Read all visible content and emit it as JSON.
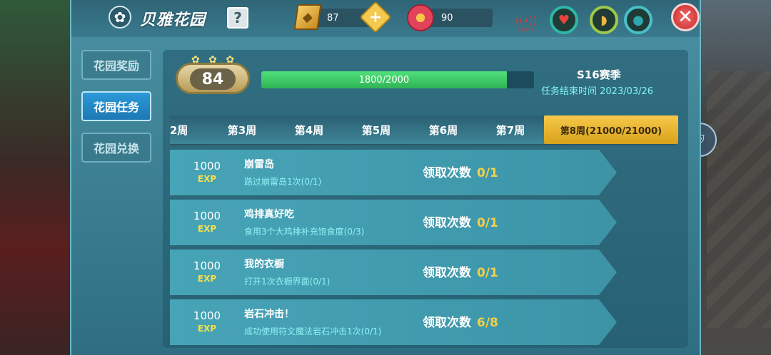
{
  "window": {
    "title": "贝雅花园"
  },
  "header": {
    "help_label": "?",
    "gems": "87",
    "add_label": "+",
    "flowers": "90",
    "signal_text": "323ms",
    "close_label": "✕"
  },
  "icons": {
    "garden": "flower-icon",
    "gem": "gem-icon",
    "flower_currency": "flower-currency-icon",
    "heart": "heart-icon",
    "food": "food-icon",
    "water": "water-icon",
    "close": "close-icon",
    "shield": "shield-icon"
  },
  "sidebar": {
    "items": [
      {
        "label": "花园奖励",
        "active": false
      },
      {
        "label": "花园任务",
        "active": true
      },
      {
        "label": "花园兑换",
        "active": false
      }
    ]
  },
  "level": {
    "value": "84"
  },
  "progress": {
    "text": "1800/2000",
    "fraction": 0.9
  },
  "season": {
    "name": "S16赛季",
    "end_text": "任务结束时间 2023/03/26"
  },
  "tabs": [
    {
      "label": "2周",
      "active": false
    },
    {
      "label": "第3周",
      "active": false
    },
    {
      "label": "第4周",
      "active": false
    },
    {
      "label": "第5周",
      "active": false
    },
    {
      "label": "第6周",
      "active": false
    },
    {
      "label": "第7周",
      "active": false
    },
    {
      "label": "第8周(21000/21000)",
      "active": true
    }
  ],
  "tasks": [
    {
      "reward": "1000",
      "exp": "EXP",
      "name": "崩雷岛",
      "desc": "路过崩雷岛1次(0/1)",
      "claim_label": "领取次数",
      "count": "0/1"
    },
    {
      "reward": "1000",
      "exp": "EXP",
      "name": "鸡排真好吃",
      "desc": "食用3个大鸡排补充饱食度(0/3)",
      "claim_label": "领取次数",
      "count": "0/1"
    },
    {
      "reward": "1000",
      "exp": "EXP",
      "name": "我的衣橱",
      "desc": "打开1次衣橱界面(0/1)",
      "claim_label": "领取次数",
      "count": "0/1"
    },
    {
      "reward": "1000",
      "exp": "EXP",
      "name": "岩石冲击！",
      "desc": "成功使用符文魔法岩石冲击1次(0/1)",
      "claim_label": "领取次数",
      "count": "6/8"
    }
  ],
  "colors": {
    "accent": "#f6c84a",
    "active_blue": "#2a9ad8",
    "progress_green": "#3fcf6a"
  }
}
